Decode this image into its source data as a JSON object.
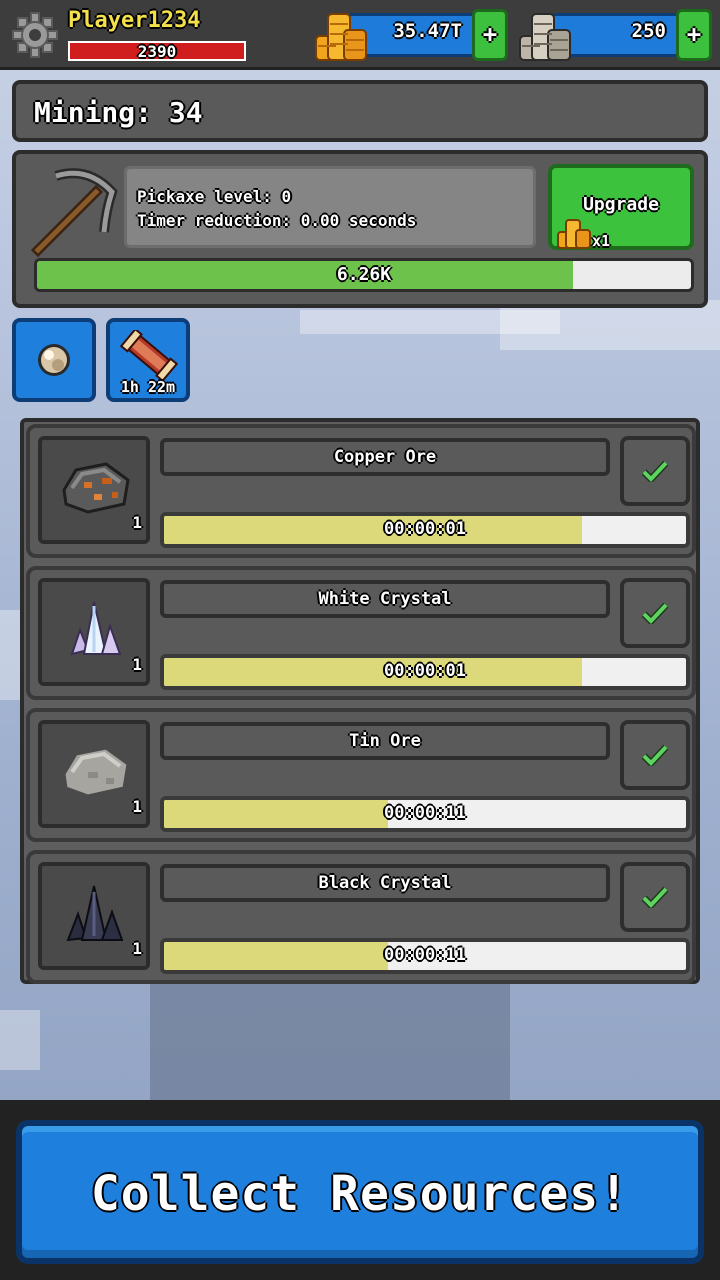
{
  "player": {
    "name": "Player1234",
    "hp": "2390"
  },
  "currency": {
    "gold": {
      "value": "35.47T",
      "plus": "+"
    },
    "silver": {
      "value": "250",
      "plus": "+"
    }
  },
  "mining": {
    "title": "Mining: 34"
  },
  "pickaxe": {
    "level_text": "Pickaxe level: 0",
    "timer_text": "Timer reduction: 0.00 seconds",
    "upgrade_label": "Upgrade",
    "upgrade_cost": "x1",
    "progress_text": "6.26K",
    "progress_fraction": 0.82
  },
  "boosts": {
    "scroll_timer": "1h 22m"
  },
  "resources": [
    {
      "name": "Copper Ore",
      "qty": "1",
      "timer": "00:00:01",
      "progress": 0.8
    },
    {
      "name": "White Crystal",
      "qty": "1",
      "timer": "00:00:01",
      "progress": 0.8
    },
    {
      "name": "Tin Ore",
      "qty": "1",
      "timer": "00:00:11",
      "progress": 0.43
    },
    {
      "name": "Black Crystal",
      "qty": "1",
      "timer": "00:00:11",
      "progress": 0.43
    }
  ],
  "collect_button": "Collect Resources!",
  "colors": {
    "accent_blue": "#1f7fdc",
    "accent_green": "#3cc23c",
    "hp_red": "#d01e1e",
    "player_yellow": "#f3e04a"
  },
  "icons": [
    "gear-icon",
    "gold-coins-icon",
    "silver-coins-icon",
    "pickaxe-icon",
    "pearl-icon",
    "scroll-icon",
    "check-icon",
    "copper-ore-icon",
    "white-crystal-icon",
    "tin-ore-icon",
    "black-crystal-icon"
  ]
}
